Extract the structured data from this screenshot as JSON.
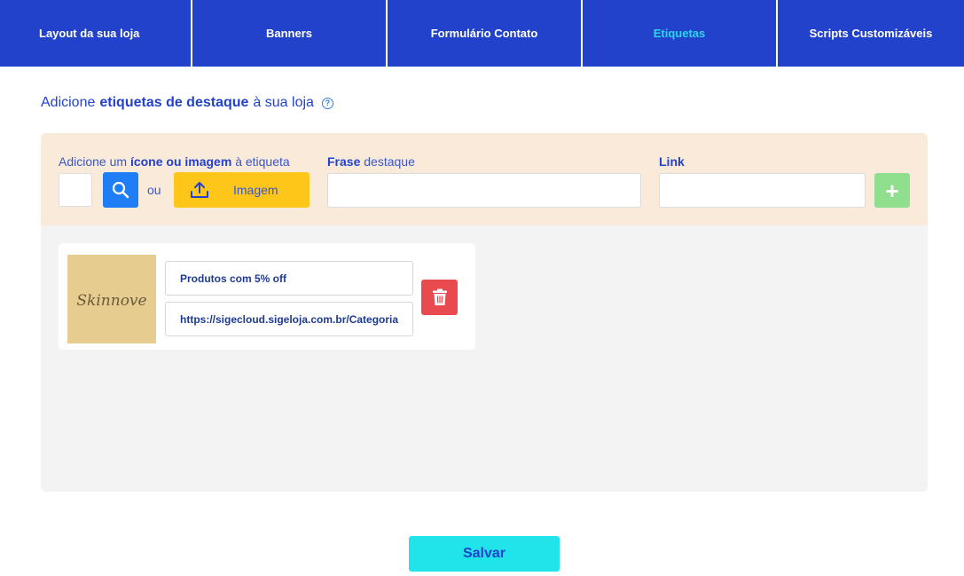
{
  "tabs": [
    {
      "label": "Layout da sua loja",
      "active": false
    },
    {
      "label": "Banners",
      "active": false
    },
    {
      "label": "Formulário Contato",
      "active": false
    },
    {
      "label": "Etiquetas",
      "active": true
    },
    {
      "label": "Scripts Customizáveis",
      "active": false
    }
  ],
  "heading": {
    "prefix": "Adicione",
    "bold": "etiquetas de destaque",
    "suffix": "à sua loja",
    "help_icon": "help-circle-icon"
  },
  "form": {
    "icon_label": {
      "prefix": "Adicione um",
      "bold": "ícone ou imagem",
      "suffix": "à etiqueta"
    },
    "ou": "ou",
    "image_button_label": "Imagem",
    "frase_label": {
      "bold": "Frase",
      "suffix": "destaque"
    },
    "frase_value": "",
    "link_label": "Link",
    "link_value": "",
    "add_button_label": "+"
  },
  "tags": [
    {
      "image_text": "Skinnove",
      "phrase": "Produtos com 5% off",
      "link": "https://sigecloud.sigeloja.com.br/Categoria"
    }
  ],
  "save_label": "Salvar",
  "colors": {
    "primary": "#2342cc",
    "active_tab": "#2ad7ea",
    "search": "#1f7ef5",
    "image_button": "#ffc61a",
    "add": "#8fdf8e",
    "delete": "#e84a4f",
    "save": "#21e3ea",
    "form_bg": "#f9ead9",
    "panel_bg": "#f3f3f3",
    "thumb_bg": "#e6cd8f"
  }
}
